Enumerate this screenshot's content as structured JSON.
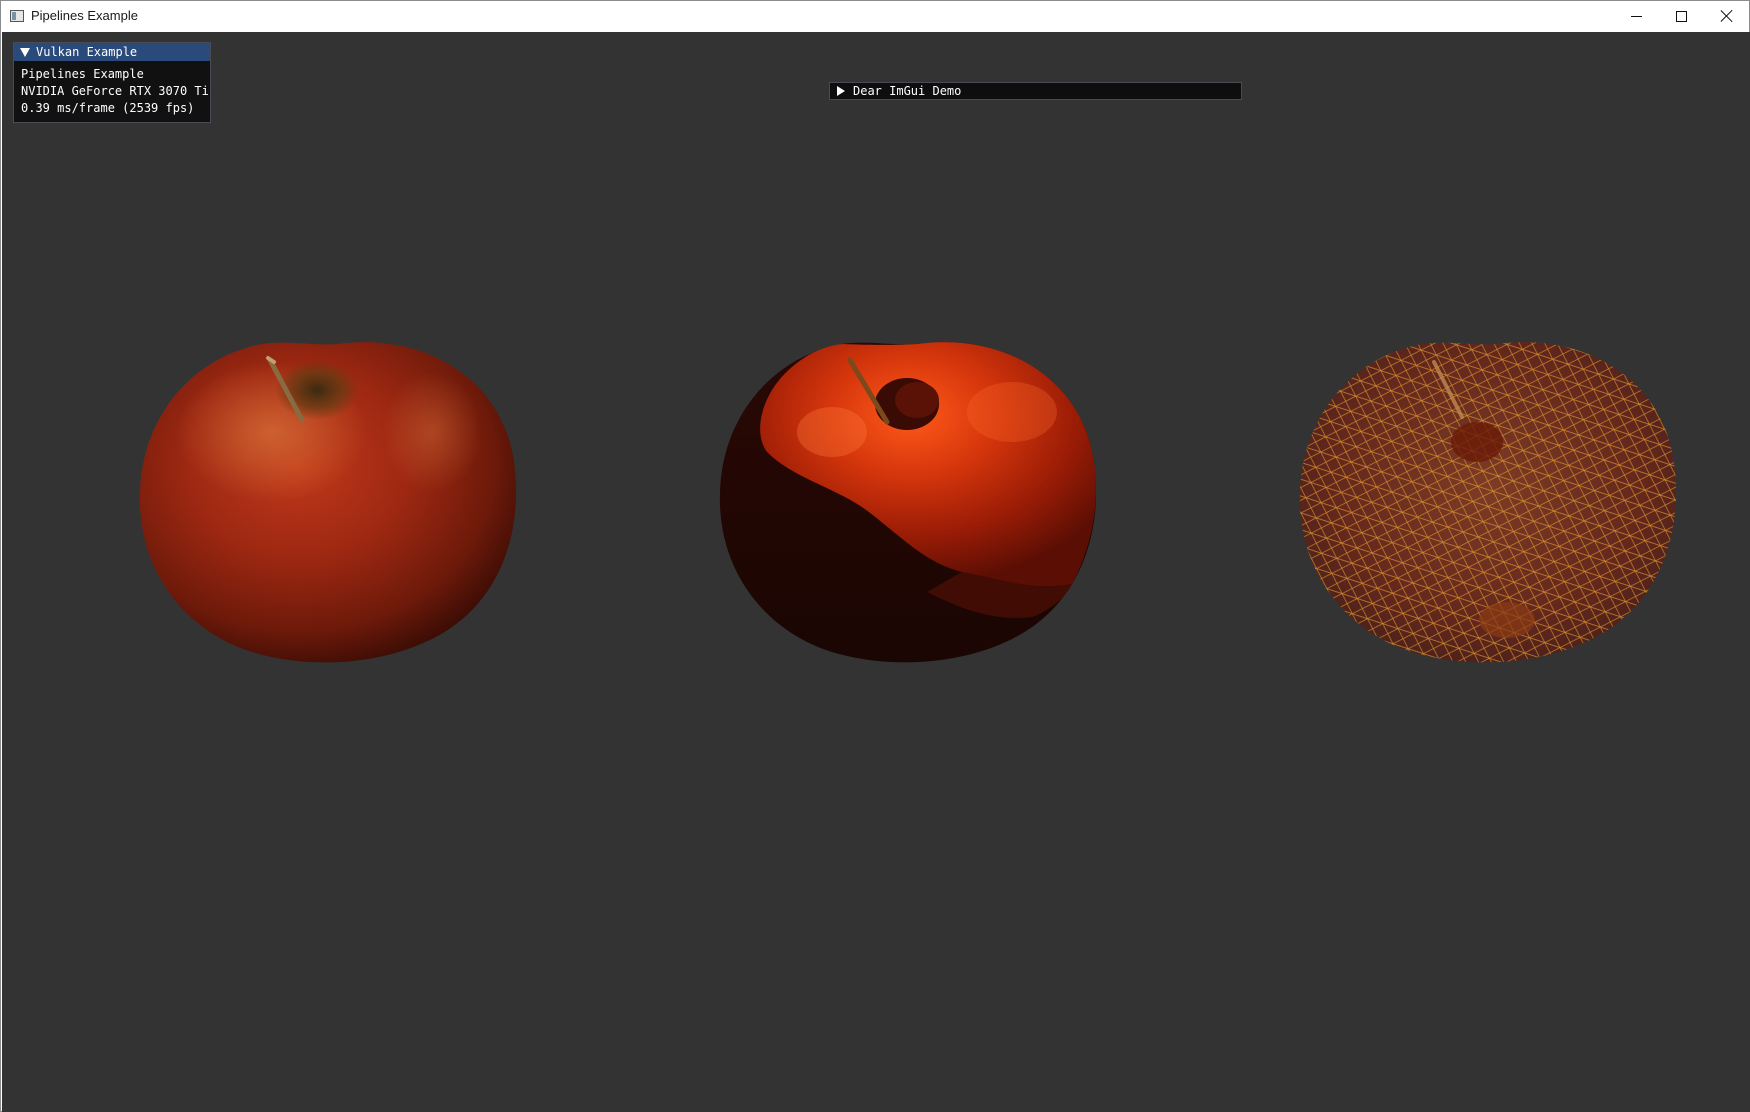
{
  "window": {
    "title": "Pipelines Example",
    "controls": {
      "minimize": "minimize",
      "maximize": "maximize",
      "close": "close"
    }
  },
  "overlay": {
    "header": "Vulkan Example",
    "lines": [
      "Pipelines Example",
      "NVIDIA GeForce RTX 3070 Ti",
      "0.39 ms/frame (2539 fps)"
    ]
  },
  "demo_window": {
    "title": "Dear ImGui Demo",
    "collapsed": true
  },
  "scene": {
    "background": "#333333",
    "objects": [
      "apple-phong",
      "apple-toon",
      "apple-wireframe"
    ]
  },
  "colors": {
    "header": "#294a7a",
    "apple_red": "#b52a10",
    "wire": "#e89a28"
  }
}
